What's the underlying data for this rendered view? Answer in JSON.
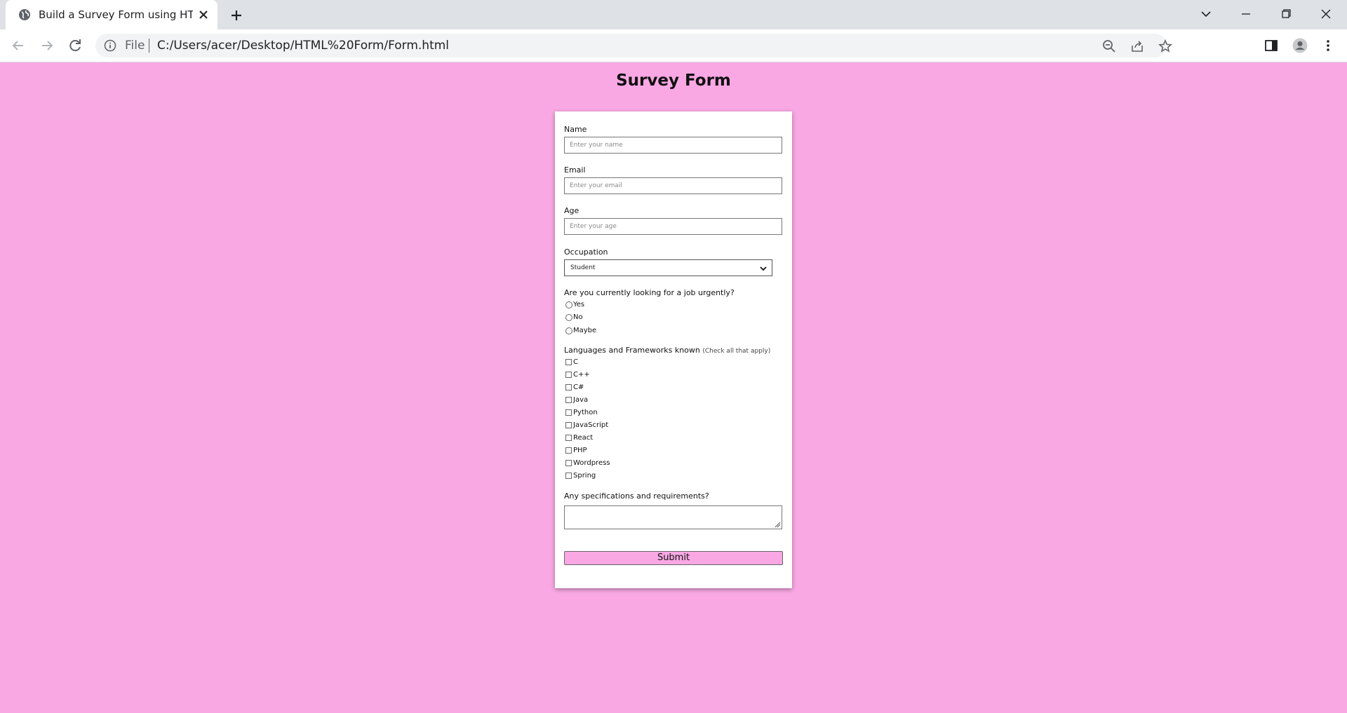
{
  "browser": {
    "tab_title": "Build a Survey Form using HTML",
    "url_scheme": "File",
    "url": "C:/Users/acer/Desktop/HTML%20Form/Form.html"
  },
  "page": {
    "title": "Survey Form",
    "background_color": "#f9a8e4"
  },
  "form": {
    "name": {
      "label": "Name",
      "placeholder": "Enter your name"
    },
    "email": {
      "label": "Email",
      "placeholder": "Enter your email"
    },
    "age": {
      "label": "Age",
      "placeholder": "Enter your age"
    },
    "occupation": {
      "label": "Occupation",
      "selected": "Student"
    },
    "job_question": {
      "label": "Are you currently looking for a job urgently?",
      "options": [
        "Yes",
        "No",
        "Maybe"
      ]
    },
    "languages": {
      "label": "Languages and Frameworks known",
      "hint": "(Check all that apply)",
      "options": [
        "C",
        "C++",
        "C#",
        "Java",
        "Python",
        "JavaScript",
        "React",
        "PHP",
        "Wordpress",
        "Spring"
      ]
    },
    "requirements": {
      "label": "Any specifications and requirements?"
    },
    "submit_label": "Submit"
  }
}
